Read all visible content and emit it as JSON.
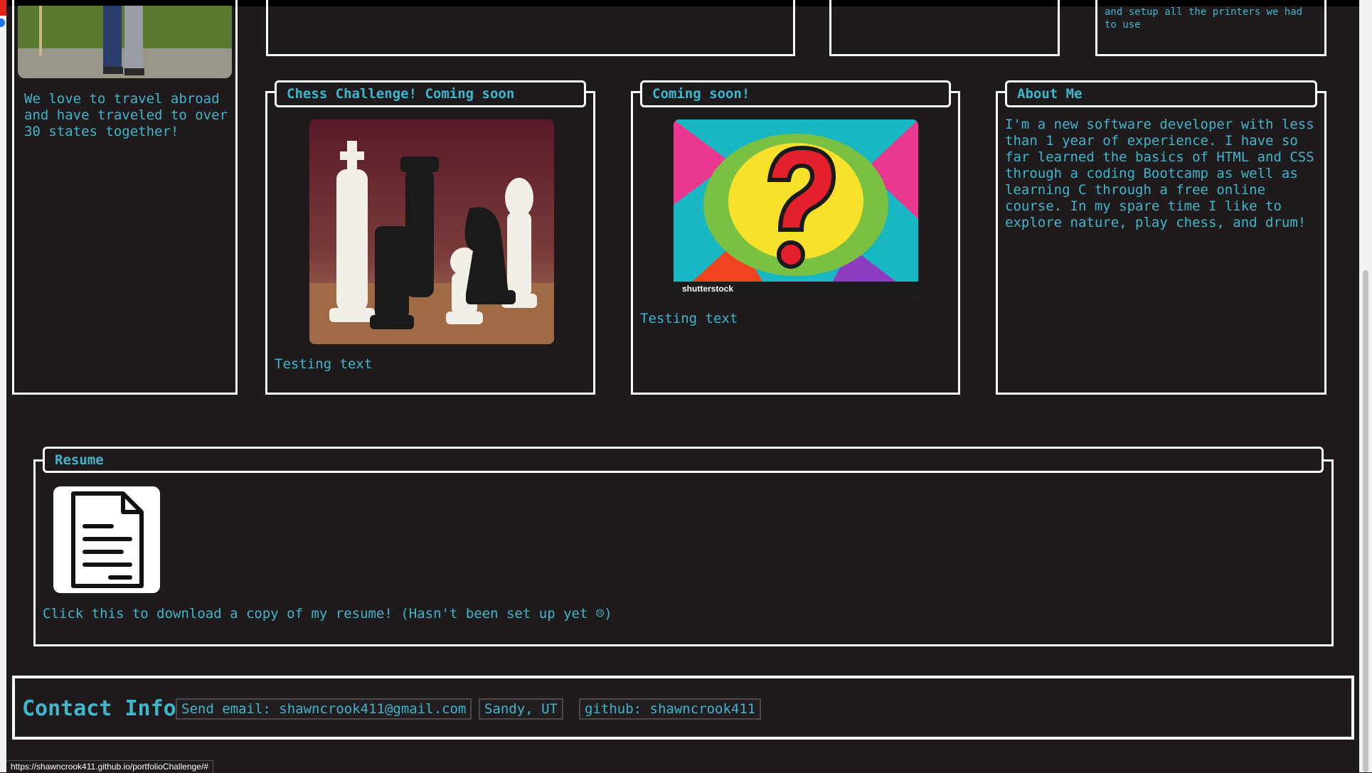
{
  "travel": {
    "text": "We love to travel abroad and have traveled to over 30 states together!"
  },
  "printers": {
    "text": "and setup all the printers we had to use"
  },
  "chess": {
    "title": "Chess Challenge! Coming soon",
    "caption": "Testing text"
  },
  "coming_soon": {
    "title": "Coming soon!",
    "caption": "Testing text",
    "image_watermark": "shutterstock"
  },
  "about": {
    "title": "About Me",
    "text": "I'm a new software developer with less than 1 year of experience. I have so far learned the basics of HTML and CSS through a coding Bootcamp as well as learning C through a free online course. In my spare time I like to explore nature, play chess, and drum!"
  },
  "resume": {
    "title": "Resume",
    "link_text": "Click this to download a copy of my resume! (Hasn't been set up yet ☹)"
  },
  "contact": {
    "title": "Contact Info:",
    "email_label": "Send email: shawncrook411@gmail.com",
    "location_label": "Sandy, UT",
    "github_label": "github: shawncrook411"
  },
  "status_url": "https://shawncrook411.github.io/portfolioChallenge/#",
  "colors": {
    "background": "#1f1b1c",
    "accent": "#3fb6cc",
    "border": "#ffffff"
  }
}
